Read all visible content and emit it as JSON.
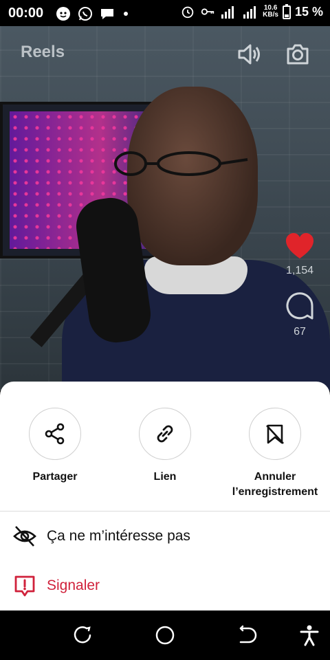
{
  "status_bar": {
    "time": "00:00",
    "net_speed_value": "10.6",
    "net_speed_unit": "KB/s",
    "battery": "15 %",
    "icons": [
      "face-icon",
      "whatsapp-icon",
      "chat-icon",
      "dot-icon",
      "alarm-icon",
      "key-icon",
      "signal-icon",
      "signal-icon",
      "battery-icon"
    ]
  },
  "header": {
    "title": "Reels",
    "icons": [
      "volume-icon",
      "camera-icon"
    ]
  },
  "side_actions": {
    "likes": "1,154",
    "comments": "67",
    "like_color": "#e0242a"
  },
  "sheet": {
    "actions": [
      {
        "label": "Partager",
        "icon": "share-icon"
      },
      {
        "label": "Lien",
        "icon": "link-icon"
      },
      {
        "label": "Annuler l’enregistrement",
        "icon": "bookmark-off-icon"
      }
    ],
    "menu": [
      {
        "label": "Ça ne m’intéresse pas",
        "icon": "eye-off-icon",
        "color": "#111111"
      },
      {
        "label": "Signaler",
        "icon": "report-icon",
        "color": "#d0213b"
      }
    ]
  },
  "nav_bar": {
    "icons": [
      "recent-apps-icon",
      "home-icon",
      "back-icon",
      "accessibility-icon"
    ]
  }
}
